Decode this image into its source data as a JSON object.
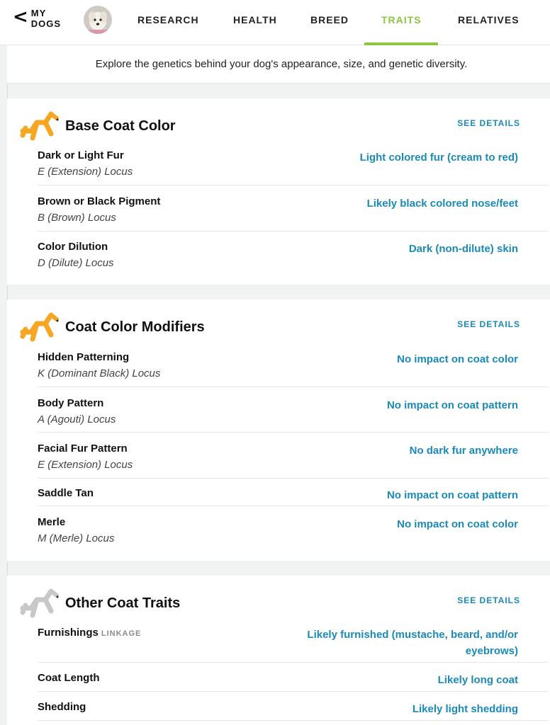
{
  "nav": {
    "back_line1": "MY",
    "back_line2": "DOGS",
    "tabs": [
      {
        "label": "RESEARCH"
      },
      {
        "label": "HEALTH"
      },
      {
        "label": "BREED"
      },
      {
        "label": "TRAITS"
      },
      {
        "label": "RELATIVES"
      }
    ],
    "active_tab": "TRAITS"
  },
  "intro": "Explore the genetics behind your dog's appearance, size, and genetic diversity.",
  "colors": {
    "accent_green": "#8cc63f",
    "link_blue": "#1a8ab8",
    "icon_orange": "#f5a623",
    "icon_grey": "#c8c8c8"
  },
  "sections": [
    {
      "title": "Base Coat Color",
      "icon": "orange-dog-icon",
      "see_details": "SEE DETAILS",
      "traits": [
        {
          "name": "Dark or Light Fur",
          "locus": "E (Extension) Locus",
          "value": "Light colored fur (cream to red)"
        },
        {
          "name": "Brown or Black Pigment",
          "locus": "B (Brown) Locus",
          "value": "Likely black colored nose/feet"
        },
        {
          "name": "Color Dilution",
          "locus": "D (Dilute) Locus",
          "value": "Dark (non-dilute) skin"
        }
      ]
    },
    {
      "title": "Coat Color Modifiers",
      "icon": "orange-dog-icon",
      "see_details": "SEE DETAILS",
      "traits": [
        {
          "name": "Hidden Patterning",
          "locus": "K (Dominant Black) Locus",
          "value": "No impact on coat color"
        },
        {
          "name": "Body Pattern",
          "locus": "A (Agouti) Locus",
          "value": "No impact on coat pattern"
        },
        {
          "name": "Facial Fur Pattern",
          "locus": "E (Extension) Locus",
          "value": "No dark fur anywhere"
        },
        {
          "name": "Saddle Tan",
          "value": "No impact on coat pattern"
        },
        {
          "name": "Merle",
          "locus": "M (Merle) Locus",
          "value": "No impact on coat color"
        }
      ]
    },
    {
      "title": "Other Coat Traits",
      "icon": "grey-dog-icon",
      "see_details": "SEE DETAILS",
      "traits": [
        {
          "name": "Furnishings",
          "tag": "LINKAGE",
          "value_line1": "Likely furnished (mustache, beard, and/or",
          "value_line2": "eyebrows)"
        },
        {
          "name": "Coat Length",
          "value": "Likely long coat"
        },
        {
          "name": "Shedding",
          "value": "Likely light shedding"
        }
      ]
    }
  ]
}
